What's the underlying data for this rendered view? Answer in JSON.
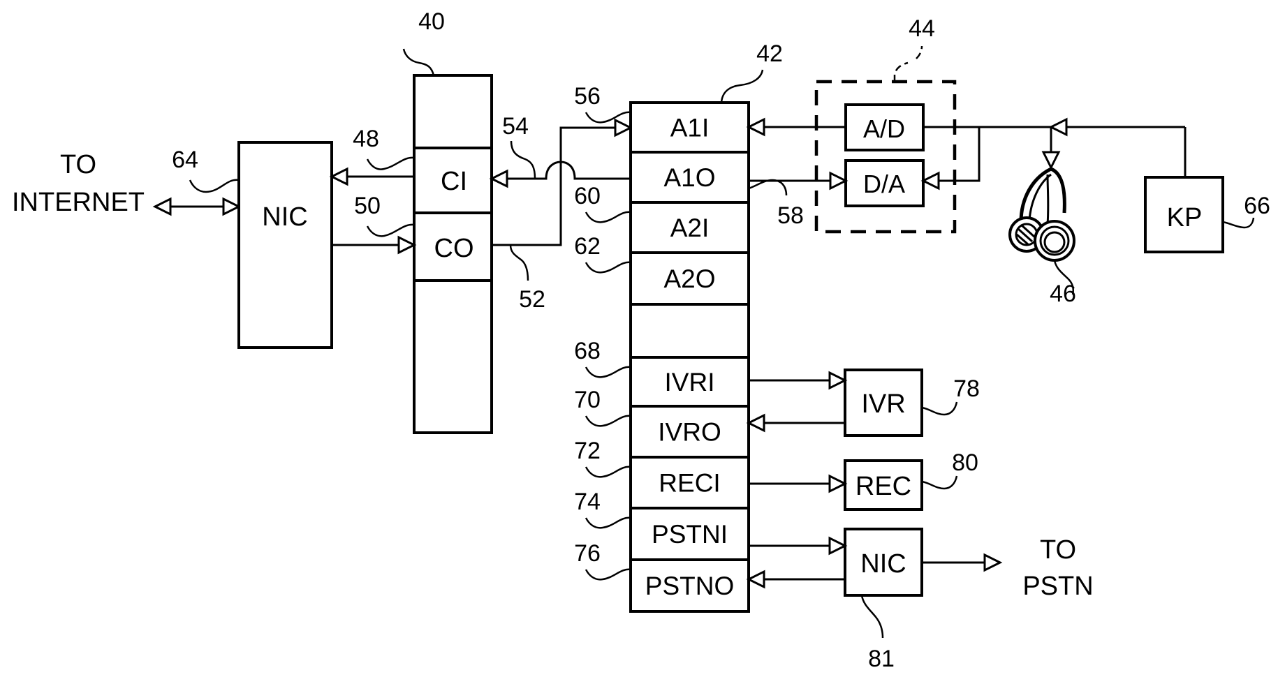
{
  "figure": {
    "nodes": {
      "nic_internet": {
        "label": "NIC",
        "ref": "64"
      },
      "client_block": {
        "ref": "40",
        "ports": [
          {
            "label": "",
            "ref": ""
          },
          {
            "label": "CI",
            "ref": "48"
          },
          {
            "label": "CO",
            "ref": "50"
          },
          {
            "label": "",
            "ref": ""
          }
        ]
      },
      "switch_block": {
        "ref": "42",
        "ports": [
          {
            "label": "A1I",
            "ref": "56"
          },
          {
            "label": "A1O",
            "ref": "58"
          },
          {
            "label": "A2I",
            "ref": "60"
          },
          {
            "label": "A2O",
            "ref": "62"
          },
          {
            "label": "",
            "ref": ""
          },
          {
            "label": "IVRI",
            "ref": "68"
          },
          {
            "label": "IVRO",
            "ref": "70"
          },
          {
            "label": "RECI",
            "ref": "72"
          },
          {
            "label": "PSTNI",
            "ref": "74"
          },
          {
            "label": "PSTNO",
            "ref": "76"
          }
        ]
      },
      "converter_group": {
        "ref": "44"
      },
      "ad": {
        "label": "A/D"
      },
      "da": {
        "label": "D/A"
      },
      "headset": {
        "ref": "46"
      },
      "keypad": {
        "label": "KP",
        "ref": "66"
      },
      "ivr": {
        "label": "IVR",
        "ref": "78"
      },
      "rec": {
        "label": "REC",
        "ref": "80"
      },
      "nic_pstn": {
        "label": "NIC",
        "ref": "81"
      }
    },
    "wire_refs": {
      "co_out": "52",
      "ci_in": "54"
    },
    "text": {
      "to_internet_1": "TO",
      "to_internet_2": "INTERNET",
      "to_pstn_1": "TO",
      "to_pstn_2": "PSTN"
    }
  }
}
